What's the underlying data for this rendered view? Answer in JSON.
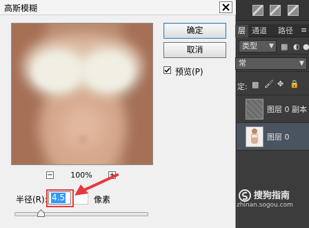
{
  "dialog": {
    "title": "高斯模糊",
    "ok_label": "确定",
    "cancel_label": "取消",
    "preview_label": "预览(P)",
    "preview_checked": true,
    "zoom_out": "−",
    "zoom_in": "+",
    "zoom_level": "100%",
    "radius_label": "半径(R):",
    "radius_value": "4.5",
    "radius_units": "像素",
    "radius_slider_fraction": 0.2
  },
  "panel": {
    "tabs": [
      "层",
      "通道",
      "路径"
    ],
    "filter_kind": "类型",
    "blend_mode": "常",
    "lock_label": "定:",
    "layers": [
      {
        "name": "图层 0 副本",
        "selected": false
      },
      {
        "name": "图层 0",
        "selected": true
      }
    ]
  },
  "watermark": {
    "text": "搜狗指南",
    "url": "zhinan.sogou.com"
  },
  "colors": {
    "highlight_red": "#e8383d",
    "selection_blue": "#3399ff",
    "panel_bg": "#3c3c3c"
  },
  "icons": [
    "close-icon",
    "check-icon",
    "arrow-icon",
    "brush-icon",
    "move-icon",
    "lock-icon",
    "sogou-logo-icon"
  ]
}
